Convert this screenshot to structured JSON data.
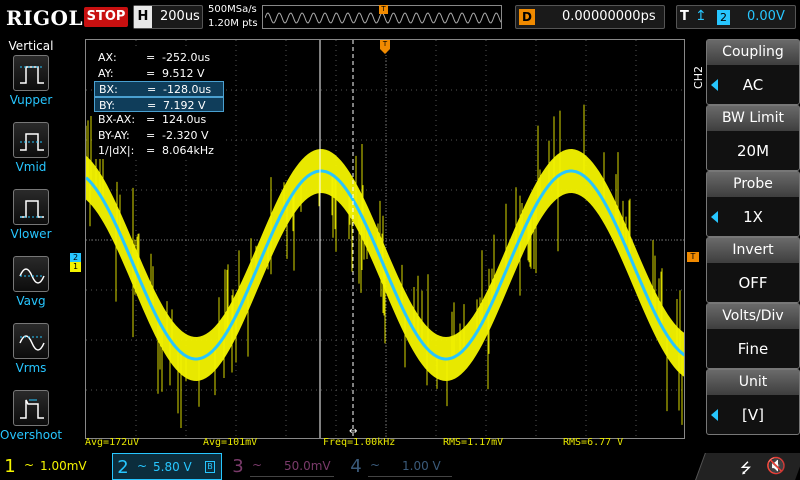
{
  "brand": "RIGOL",
  "run_state": "STOP",
  "timebase": {
    "key": "H",
    "value": "200us"
  },
  "sample": {
    "rate": "500MSa/s",
    "points": "1.20M pts"
  },
  "delay": {
    "key": "D",
    "value": "0.00000000ps"
  },
  "trigger": {
    "key": "T",
    "source": "2",
    "level": "0.00V",
    "edge_icon": "rising-edge-icon"
  },
  "vertical_menu": {
    "title": "Vertical",
    "items": [
      {
        "label": "Vupper",
        "icon": "vupper-icon"
      },
      {
        "label": "Vmid",
        "icon": "vmid-icon"
      },
      {
        "label": "Vlower",
        "icon": "vlower-icon"
      },
      {
        "label": "Vavg",
        "icon": "vavg-icon"
      },
      {
        "label": "Vrms",
        "icon": "vrms-icon"
      },
      {
        "label": "Overshoot",
        "icon": "overshoot-icon"
      }
    ]
  },
  "cursor_readout": [
    {
      "key": "AX:",
      "eq": "=",
      "value": "-252.0us",
      "selected": false
    },
    {
      "key": "AY:",
      "eq": "=",
      "value": "9.512 V",
      "selected": false
    },
    {
      "key": "BX:",
      "eq": "=",
      "value": "-128.0us",
      "selected": true
    },
    {
      "key": "BY:",
      "eq": "=",
      "value": "7.192 V",
      "selected": true
    },
    {
      "key": "BX-AX:",
      "eq": "=",
      "value": "124.0us",
      "selected": false
    },
    {
      "key": "BY-AY:",
      "eq": "=",
      "value": "-2.320 V",
      "selected": false
    },
    {
      "key": "1/|dX|:",
      "eq": "=",
      "value": "8.064kHz",
      "selected": false
    }
  ],
  "channel_menu": {
    "tag": "CH2",
    "items": [
      {
        "label": "Coupling",
        "value": "AC"
      },
      {
        "label": "BW Limit",
        "value": "20M"
      },
      {
        "label": "Probe",
        "value": "1X"
      },
      {
        "label": "Invert",
        "value": "OFF"
      },
      {
        "label": "Volts/Div",
        "value": "Fine"
      },
      {
        "label": "Unit",
        "value": "[V]"
      }
    ]
  },
  "measurements": [
    {
      "text": "Avg=172uV"
    },
    {
      "text": "Avg=101mV"
    },
    {
      "text": "Freq=1.00kHz"
    },
    {
      "text": "RMS=1.17mV"
    },
    {
      "text": "RMS=6.77 V"
    }
  ],
  "channels": [
    {
      "num": "1",
      "coupling": "~",
      "scale": "1.00mV",
      "color": "#f4f400",
      "active": false
    },
    {
      "num": "2",
      "coupling": "~",
      "scale": "5.80 V",
      "color": "#27c6ff",
      "active": true
    },
    {
      "num": "3",
      "coupling": "~",
      "scale": "50.0mV",
      "color": "#7a3a6a",
      "active": false
    },
    {
      "num": "4",
      "coupling": "~",
      "scale": "1.00 V",
      "color": "#3a5a7a",
      "active": false
    }
  ],
  "markers": {
    "ch2": "2",
    "ch1": "1",
    "trig_level": "T",
    "trig_pos": "T"
  },
  "colors": {
    "ch1": "#f4f400",
    "ch2": "#27c6ff",
    "trigger": "#f08a00",
    "stop": "#c81010"
  }
}
